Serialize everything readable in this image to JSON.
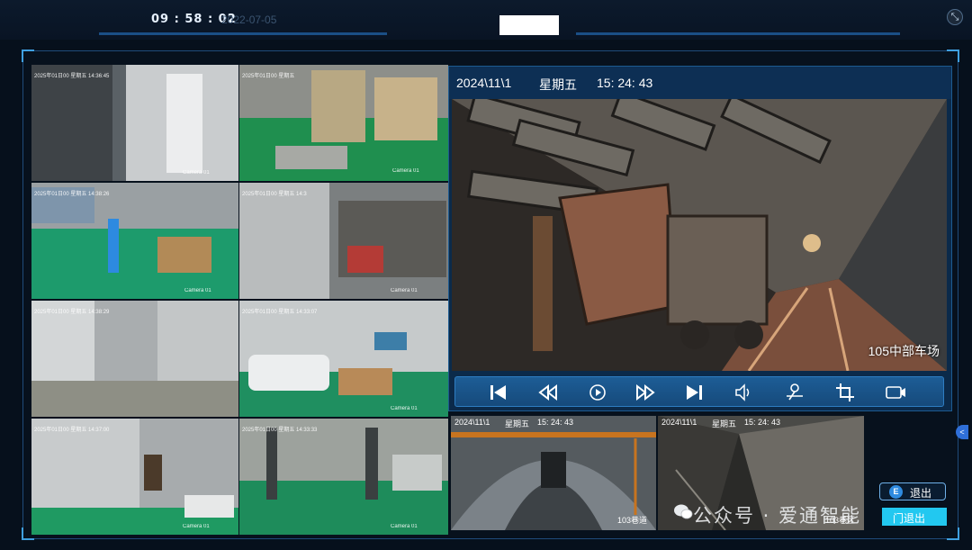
{
  "header": {
    "clock": "09 : 58 : 02",
    "date_ghost": "2022-07-05",
    "fullscreen_icon": "fullscreen-exit-icon"
  },
  "grid": {
    "cams": [
      {
        "stamp": "2025年01日00  星期五  14:36:45",
        "label": "Camera 01"
      },
      {
        "stamp": "2025年01日00  星期五",
        "label": "Camera 01"
      },
      {
        "stamp": "2025年01日00  星期五  14:38:26",
        "label": "Camera 01"
      },
      {
        "stamp": "2025年01日00  星期五  14:3",
        "label": "Camera 01"
      },
      {
        "stamp": "2025年01日00  星期五  14:38:29",
        "label": ""
      },
      {
        "stamp": "2025年01日00  星期五  14:33:07",
        "label": "Camera 01"
      },
      {
        "stamp": "2025年01日00  星期五  14:37:00",
        "label": "Camera 01"
      },
      {
        "stamp": "2025年01日00  星期五  14:33:33",
        "label": "Camera 01"
      }
    ]
  },
  "main": {
    "date": "2024\\11\\1",
    "weekday": "星期五",
    "time": "15:  24:  43",
    "location": "105中部车场"
  },
  "controls": {
    "icons": [
      "skip-start-icon",
      "rewind-icon",
      "play-icon",
      "fast-forward-icon",
      "skip-end-icon",
      "volume-icon",
      "ptz-icon",
      "crop-icon",
      "record-icon"
    ]
  },
  "small1": {
    "date": "2024\\11\\1",
    "weekday": "星期五",
    "time": "15:  24:  43",
    "label": "103巷道"
  },
  "small2": {
    "date": "2024\\11\\1",
    "weekday": "星期五",
    "time": "15:  24:  43",
    "label": "103巷区"
  },
  "buttons": {
    "exit_label": "退出",
    "exit_icon_letter": "E",
    "exit2_label": "门退出"
  },
  "watermark": "公众号 · 爱通智能",
  "side_pin": "<"
}
